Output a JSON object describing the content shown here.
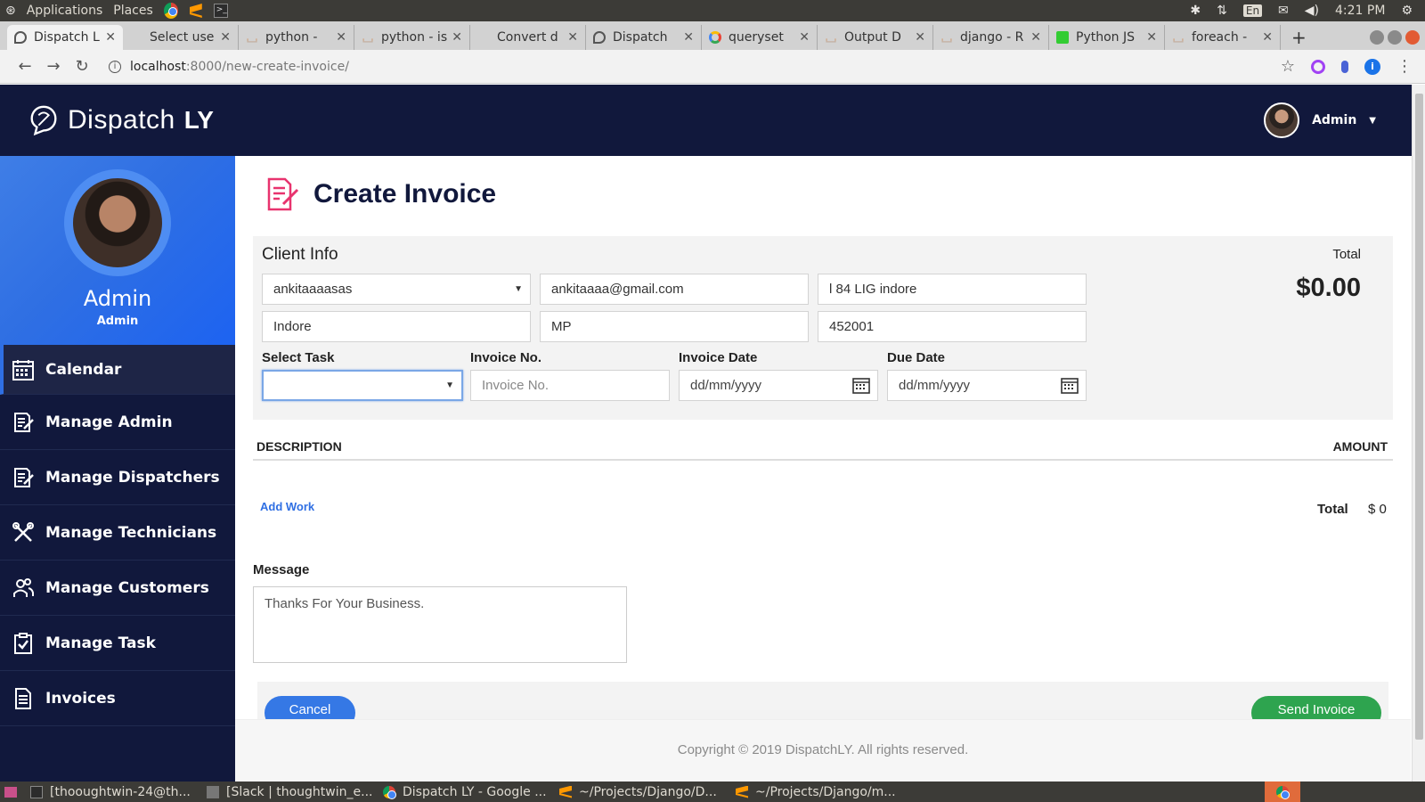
{
  "os": {
    "applications_label": "Applications",
    "places_label": "Places",
    "lang": "En",
    "time": "4:21 PM"
  },
  "browser": {
    "tabs": [
      {
        "title": "Dispatch L",
        "icon": "dispatch-icon"
      },
      {
        "title": "Select use",
        "icon": "none"
      },
      {
        "title": "python - ",
        "icon": "stackoverflow-icon"
      },
      {
        "title": "python - is",
        "icon": "stackoverflow-icon"
      },
      {
        "title": "Convert d",
        "icon": "none"
      },
      {
        "title": "Dispatch",
        "icon": "dispatch-icon"
      },
      {
        "title": "queryset",
        "icon": "google-icon"
      },
      {
        "title": "Output D",
        "icon": "stackoverflow-icon"
      },
      {
        "title": "django - R",
        "icon": "stackoverflow-icon"
      },
      {
        "title": "Python JS",
        "icon": "json-icon"
      },
      {
        "title": "foreach - ",
        "icon": "stackoverflow-icon"
      }
    ],
    "url_host": "localhost",
    "url_rest": ":8000/new-create-invoice/"
  },
  "header": {
    "brand_name": "Dispatch",
    "brand_strong": "LY",
    "user_name": "Admin"
  },
  "sidebar": {
    "profile_name": "Admin",
    "profile_role": "Admin",
    "items": [
      {
        "label": "Calendar",
        "icon": "calendar-icon"
      },
      {
        "label": "Manage Admin",
        "icon": "edit-doc-icon"
      },
      {
        "label": "Manage Dispatchers",
        "icon": "edit-doc-icon"
      },
      {
        "label": "Manage Technicians",
        "icon": "tools-icon"
      },
      {
        "label": "Manage Customers",
        "icon": "users-icon"
      },
      {
        "label": "Manage Task",
        "icon": "clipboard-check-icon"
      },
      {
        "label": "Invoices",
        "icon": "invoice-icon"
      }
    ]
  },
  "main": {
    "page_title": "Create Invoice",
    "client_info_label": "Client Info",
    "total_label": "Total",
    "total_value": "$0.00",
    "client_select_value": "ankitaaaasas",
    "email_value": "ankitaaaa@gmail.com",
    "address_value": "l 84 LIG indore",
    "city_value": "Indore",
    "state_value": "MP",
    "zip_value": "452001",
    "select_task_label": "Select Task",
    "select_task_value": "",
    "invoice_no_label": "Invoice No.",
    "invoice_no_placeholder": "Invoice No.",
    "invoice_date_label": "Invoice Date",
    "invoice_date_placeholder": "dd/mm/yyyy",
    "due_date_label": "Due Date",
    "due_date_placeholder": "dd/mm/yyyy",
    "description_header": "DESCRIPTION",
    "amount_header": "AMOUNT",
    "add_work_label": "Add Work",
    "sum_label": "Total",
    "sum_value": "$ 0",
    "message_label": "Message",
    "message_value": "Thanks For Your Business.",
    "cancel_label": "Cancel",
    "send_label": "Send Invoice",
    "footer_text": "Copyright © 2019 DispatchLY. All rights reserved."
  },
  "taskbar": {
    "items": [
      {
        "label": "[thooughtwin-24@th...",
        "icon": "terminal-icon"
      },
      {
        "label": "[Slack | thoughtwin_e...",
        "icon": "window-icon"
      },
      {
        "label": "Dispatch LY - Google ...",
        "icon": "chrome-icon"
      },
      {
        "label": "~/Projects/Django/D...",
        "icon": "sublime-icon"
      },
      {
        "label": "~/Projects/Django/m...",
        "icon": "sublime-icon"
      }
    ]
  },
  "colors": {
    "header_bg": "#11183c",
    "sidebar_bg": "#11183c",
    "accent_blue": "#2f6fe3",
    "send_green": "#2ea44f",
    "title_icon_pink": "#e8336e"
  }
}
